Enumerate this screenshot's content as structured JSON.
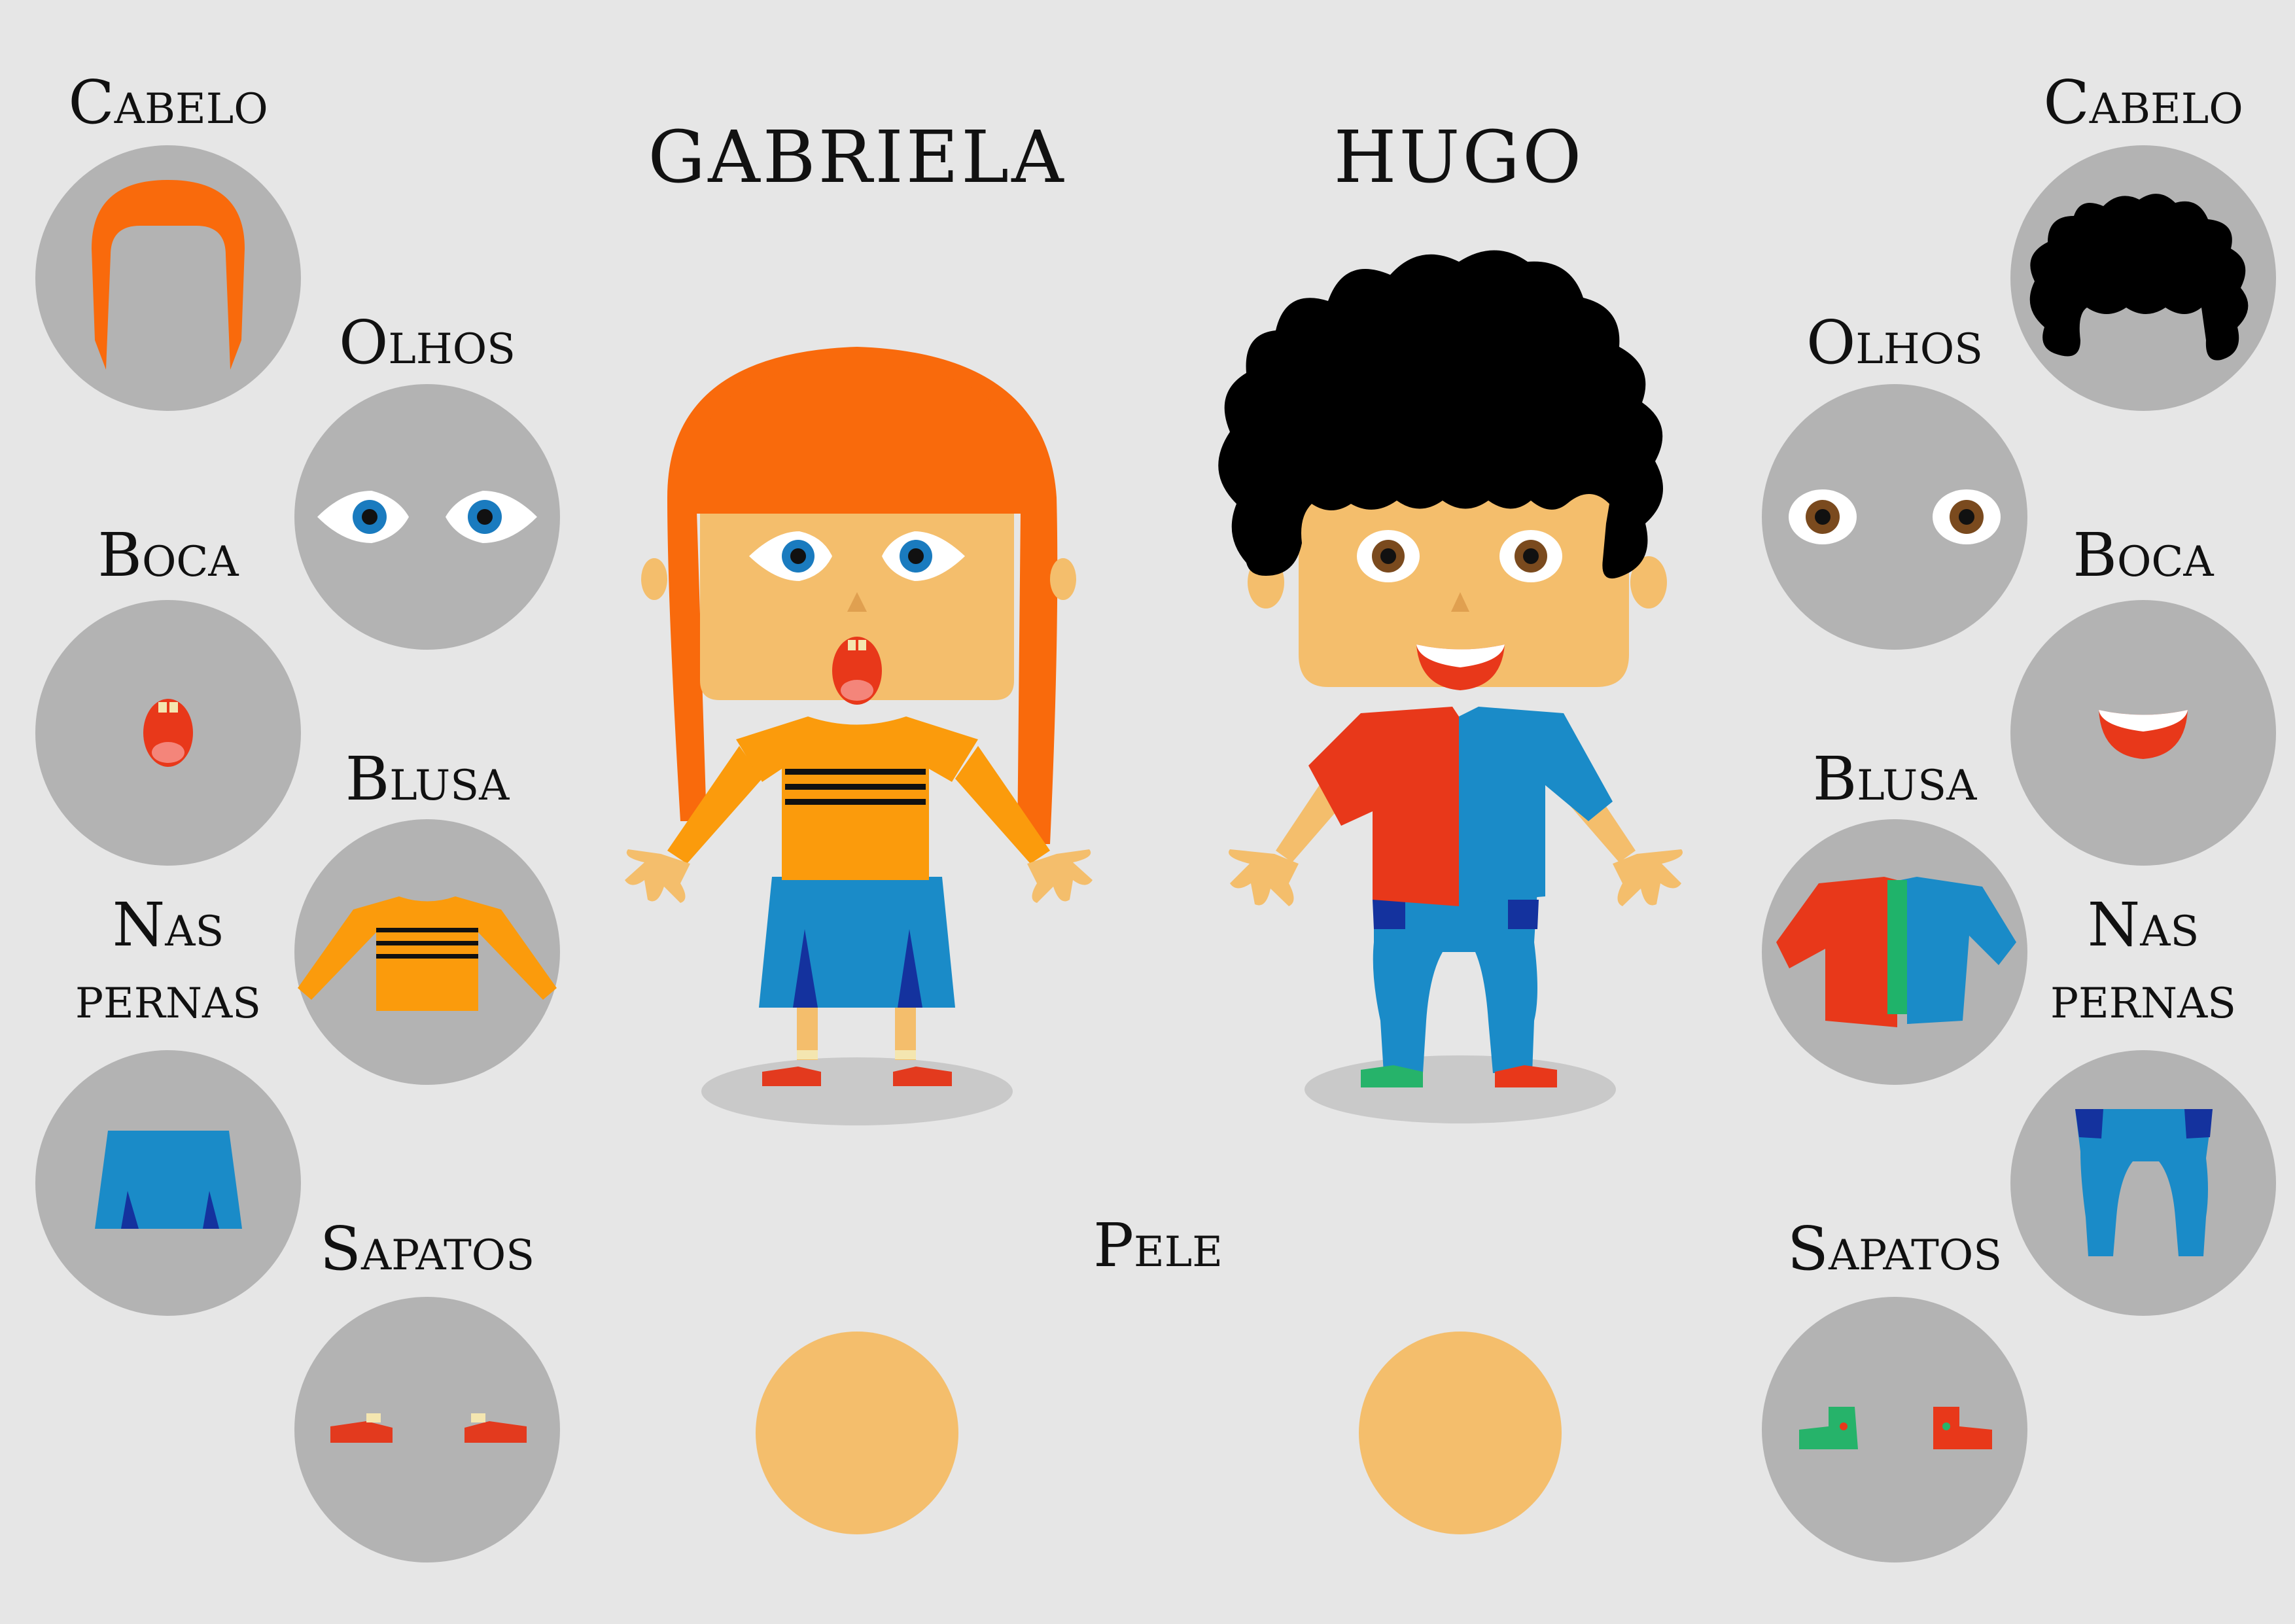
{
  "characters": {
    "left_name": "GABRIELA",
    "right_name": "HUGO"
  },
  "labels": {
    "hair": "Cabelo",
    "eyes": "Olhos",
    "mouth": "Boca",
    "shirt": "Blusa",
    "legs_line1": "Nas",
    "legs_line2": "pernas",
    "shoes": "Sapatos",
    "skin": "Pele"
  },
  "colors": {
    "background": "#e6e6e6",
    "option_circle": "#b3b3b3",
    "gabriela_hair": "#f96a0c",
    "gabriela_eyes": "#1a7bbf",
    "gabriela_shirt": "#fb9b0c",
    "gabriela_skirt": "#1a8bc8",
    "gabriela_shoes": "#e33a1e",
    "hugo_hair": "#000000",
    "hugo_eyes": "#7a4a1e",
    "hugo_jacket_left": "#e8381a",
    "hugo_jacket_right": "#1a8bc8",
    "hugo_shirt": "#1fb36a",
    "hugo_pants": "#1a8bc8",
    "hugo_shoe_left": "#26b36a",
    "hugo_shoe_right": "#e8381a",
    "skin": "#f4be6c"
  },
  "icons": {
    "gabriela_hair": "straight-bob-hair-icon",
    "gabriela_eyes": "blue-eyes-icon",
    "gabriela_mouth": "open-mouth-icon",
    "gabriela_shirt": "striped-sweater-icon",
    "gabriela_legs": "skirt-icon",
    "gabriela_shoes": "red-shoes-icon",
    "hugo_hair": "curly-hair-icon",
    "hugo_eyes": "brown-eyes-icon",
    "hugo_mouth": "smile-icon",
    "hugo_shirt": "jacket-icon",
    "hugo_legs": "jeans-icon",
    "hugo_shoes": "boots-icon",
    "skin_swatch": "skin-swatch-icon"
  }
}
